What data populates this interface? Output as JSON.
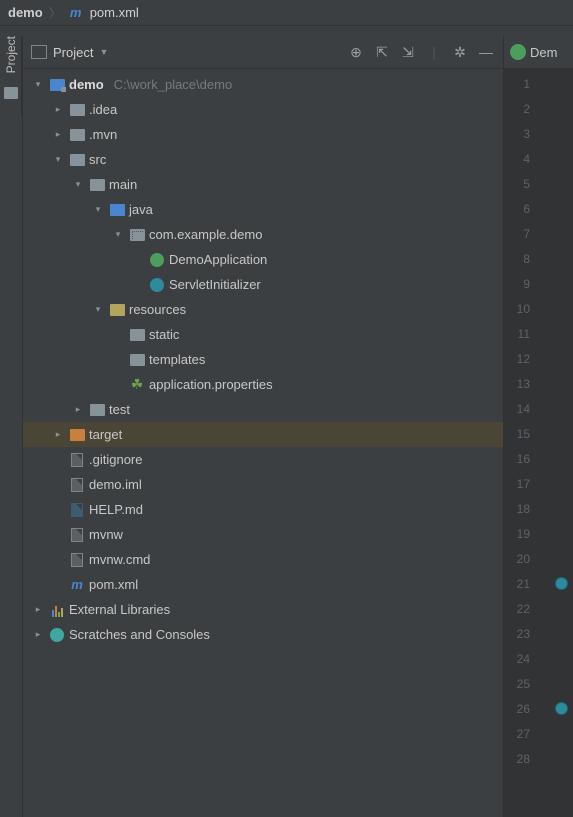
{
  "breadcrumb": {
    "root": "demo",
    "file": "pom.xml"
  },
  "sidebar": {
    "label": "Project"
  },
  "panel": {
    "title": "Project",
    "toolbar_icons": [
      "target",
      "expand",
      "collapse",
      "sep",
      "gear",
      "minimize"
    ]
  },
  "tree": [
    {
      "depth": 0,
      "arrow": "down",
      "icon": "module",
      "label": "demo",
      "bold": true,
      "path": "C:\\work_place\\demo"
    },
    {
      "depth": 1,
      "arrow": "right",
      "icon": "folder",
      "label": ".idea"
    },
    {
      "depth": 1,
      "arrow": "right",
      "icon": "folder",
      "label": ".mvn"
    },
    {
      "depth": 1,
      "arrow": "down",
      "icon": "folder",
      "label": "src"
    },
    {
      "depth": 2,
      "arrow": "down",
      "icon": "folder",
      "label": "main"
    },
    {
      "depth": 3,
      "arrow": "down",
      "icon": "folder-blue",
      "label": "java"
    },
    {
      "depth": 4,
      "arrow": "down",
      "icon": "pkg",
      "label": "com.example.demo"
    },
    {
      "depth": 5,
      "arrow": "none",
      "icon": "class-green",
      "label": "DemoApplication"
    },
    {
      "depth": 5,
      "arrow": "none",
      "icon": "class-cyan",
      "label": "ServletInitializer"
    },
    {
      "depth": 3,
      "arrow": "down",
      "icon": "folder-yellow",
      "label": "resources"
    },
    {
      "depth": 4,
      "arrow": "none",
      "icon": "folder",
      "label": "static"
    },
    {
      "depth": 4,
      "arrow": "none",
      "icon": "folder",
      "label": "templates"
    },
    {
      "depth": 4,
      "arrow": "none",
      "icon": "leaf",
      "label": "application.properties"
    },
    {
      "depth": 2,
      "arrow": "right",
      "icon": "folder",
      "label": "test"
    },
    {
      "depth": 1,
      "arrow": "right",
      "icon": "folder-orange",
      "label": "target",
      "selected": true
    },
    {
      "depth": 1,
      "arrow": "none",
      "icon": "file",
      "label": ".gitignore"
    },
    {
      "depth": 1,
      "arrow": "none",
      "icon": "file",
      "label": "demo.iml"
    },
    {
      "depth": 1,
      "arrow": "none",
      "icon": "file-md",
      "label": "HELP.md"
    },
    {
      "depth": 1,
      "arrow": "none",
      "icon": "file",
      "label": "mvnw"
    },
    {
      "depth": 1,
      "arrow": "none",
      "icon": "file",
      "label": "mvnw.cmd"
    },
    {
      "depth": 1,
      "arrow": "none",
      "icon": "maven",
      "label": "pom.xml"
    },
    {
      "depth": 0,
      "arrow": "right",
      "icon": "libs",
      "label": "External Libraries"
    },
    {
      "depth": 0,
      "arrow": "right",
      "icon": "scratch",
      "label": "Scratches and Consoles"
    }
  ],
  "editor": {
    "tab_label": "Dem",
    "line_count": 28,
    "gutter_marks": {
      "21": true,
      "26": true
    }
  }
}
